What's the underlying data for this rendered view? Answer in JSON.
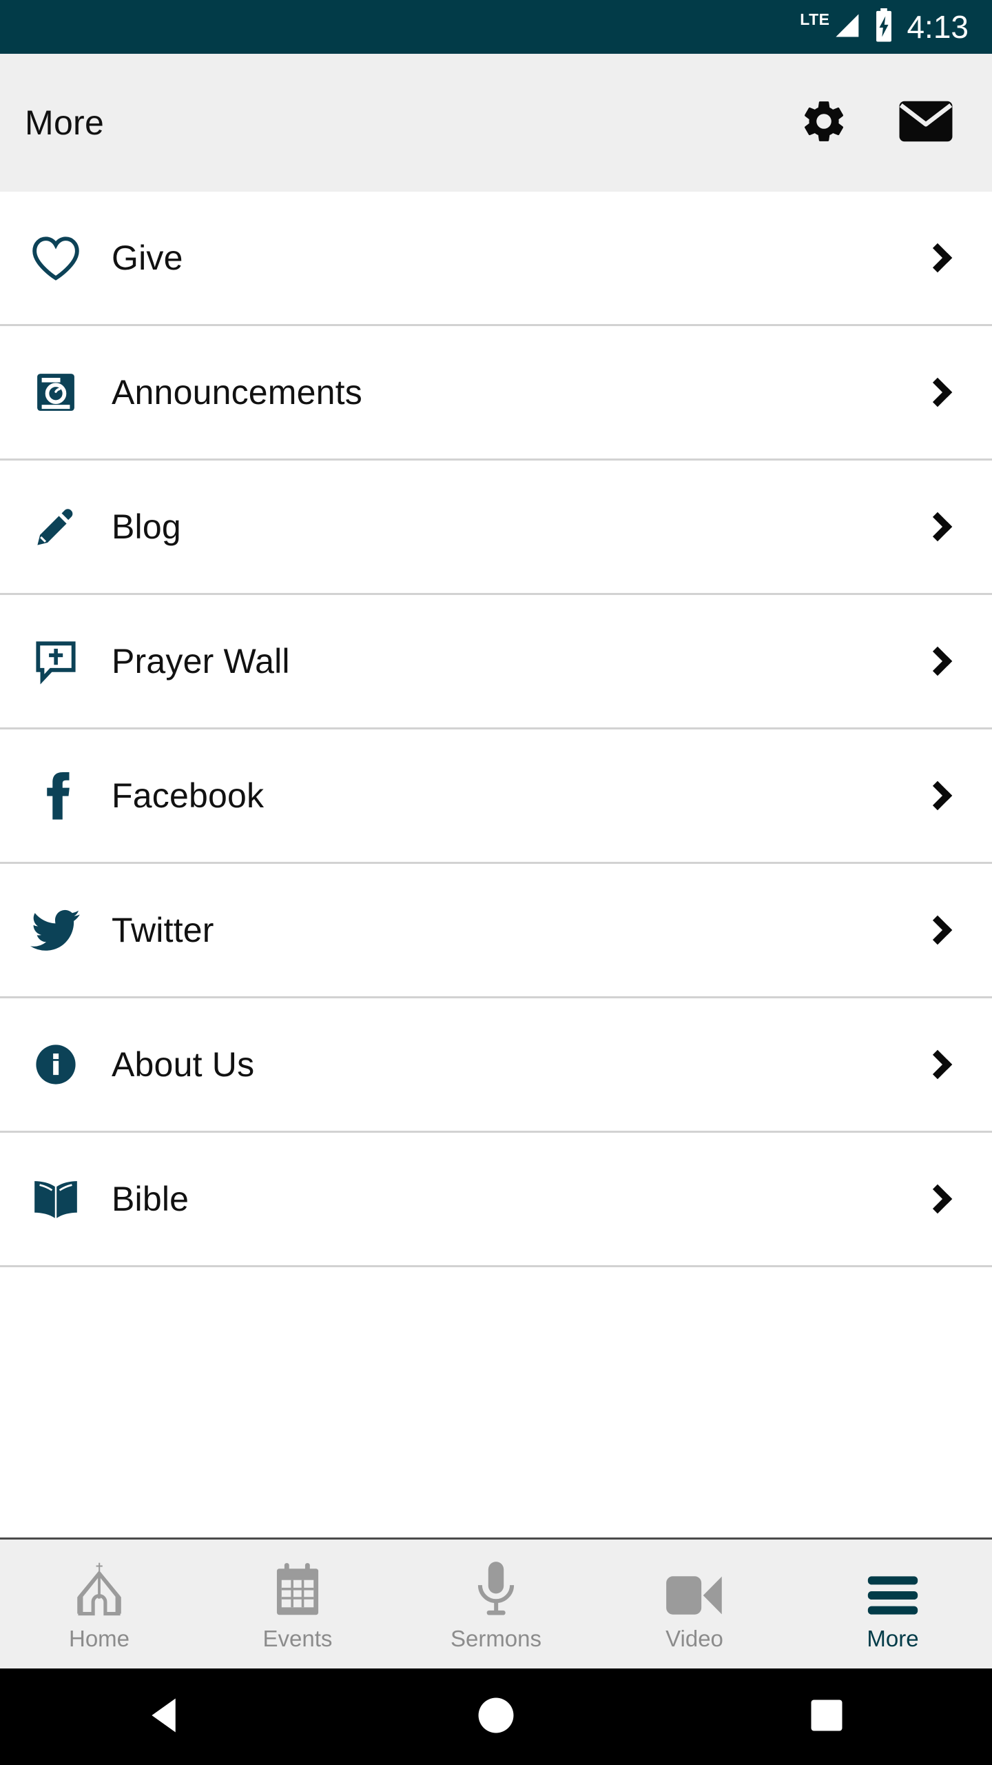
{
  "status_bar": {
    "network_label": "LTE",
    "signal_icon": "signal-triangle-icon",
    "battery_icon": "battery-charging-icon",
    "time": "4:13",
    "background_color": "#023B48",
    "foreground_color": "#FFFFFF"
  },
  "header": {
    "title": "More",
    "background_color": "#EFEFEF",
    "settings_icon": "gear-icon",
    "mail_icon": "envelope-icon"
  },
  "theme": {
    "accent_color": "#023B48",
    "icon_teal": "#0C4257",
    "divider_color": "#D2D2D2",
    "inactive_gray": "#9B9B9B"
  },
  "menu": {
    "items": [
      {
        "label": "Give",
        "icon": "heart-outline-icon",
        "chevron": "chevron-right-icon"
      },
      {
        "label": "Announcements",
        "icon": "camera-icon",
        "chevron": "chevron-right-icon"
      },
      {
        "label": "Blog",
        "icon": "pencil-icon",
        "chevron": "chevron-right-icon"
      },
      {
        "label": "Prayer Wall",
        "icon": "speech-bubble-cross-icon",
        "chevron": "chevron-right-icon"
      },
      {
        "label": "Facebook",
        "icon": "facebook-icon",
        "chevron": "chevron-right-icon"
      },
      {
        "label": "Twitter",
        "icon": "twitter-bird-icon",
        "chevron": "chevron-right-icon"
      },
      {
        "label": "About Us",
        "icon": "info-circle-icon",
        "chevron": "chevron-right-icon"
      },
      {
        "label": "Bible",
        "icon": "open-book-icon",
        "chevron": "chevron-right-icon"
      }
    ]
  },
  "tab_bar": {
    "tabs": [
      {
        "label": "Home",
        "icon": "church-icon",
        "active": false
      },
      {
        "label": "Events",
        "icon": "calendar-icon",
        "active": false
      },
      {
        "label": "Sermons",
        "icon": "microphone-icon",
        "active": false
      },
      {
        "label": "Video",
        "icon": "video-camera-icon",
        "active": false
      },
      {
        "label": "More",
        "icon": "hamburger-icon",
        "active": true
      }
    ]
  },
  "nav_bar": {
    "back_icon": "back-triangle-icon",
    "home_icon": "home-circle-icon",
    "recents_icon": "recents-square-icon",
    "background_color": "#000000"
  }
}
